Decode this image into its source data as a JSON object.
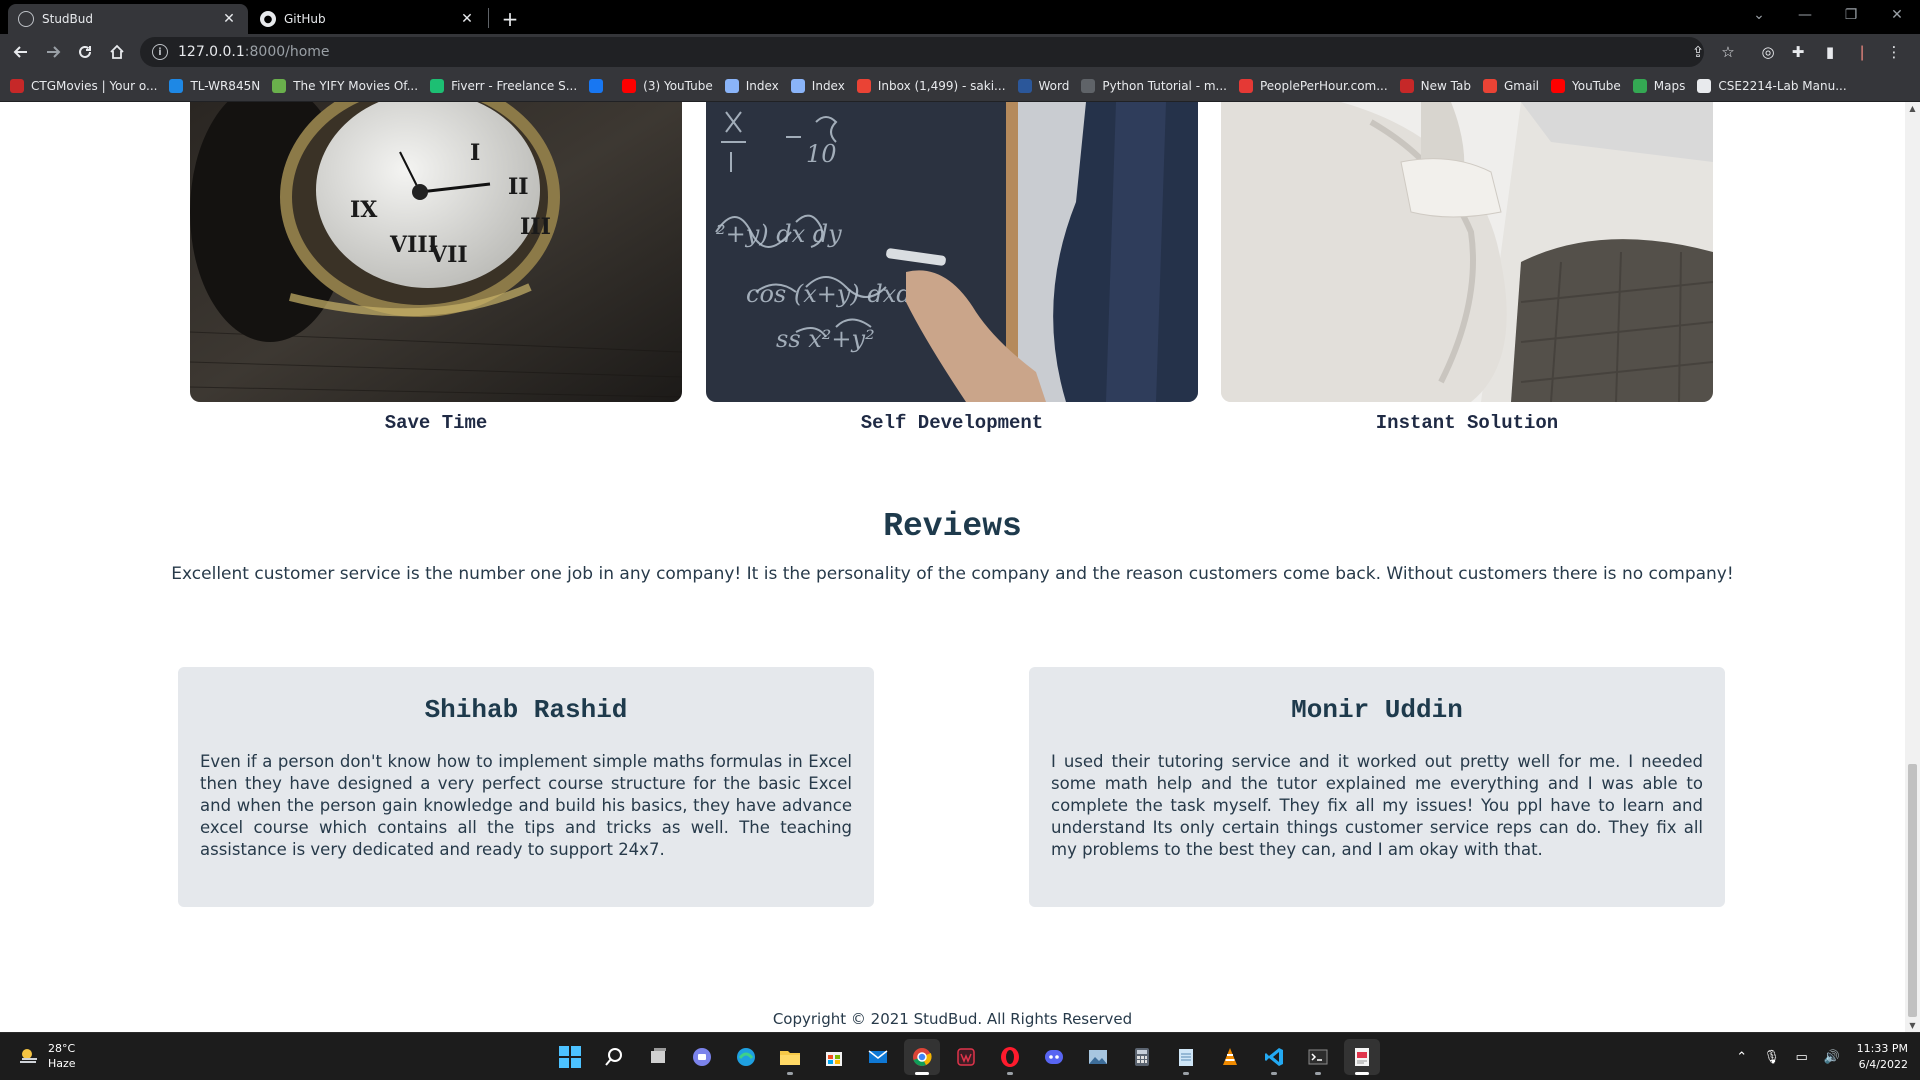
{
  "browser": {
    "tabs": [
      {
        "title": "StudBud",
        "active": true
      },
      {
        "title": "GitHub",
        "active": false
      }
    ],
    "url_host": "127.0.0.1",
    "url_path": ":8000/home",
    "bookmarks": [
      {
        "label": "CTGMovies | Your o...",
        "color": "#c62828"
      },
      {
        "label": "TL-WR845N",
        "color": "#1e88e5"
      },
      {
        "label": "The YIFY Movies Of...",
        "color": "#6ab04c"
      },
      {
        "label": "Fiverr - Freelance S...",
        "color": "#1dbf73"
      },
      {
        "label": "",
        "color": "#1877f2"
      },
      {
        "label": "(3) YouTube",
        "color": "#ff0000"
      },
      {
        "label": "Index",
        "color": "#8ab4f8"
      },
      {
        "label": "Index",
        "color": "#8ab4f8"
      },
      {
        "label": "Inbox (1,499) - saki...",
        "color": "#ea4335"
      },
      {
        "label": "Word",
        "color": "#2b579a"
      },
      {
        "label": "Python Tutorial - m...",
        "color": "#5f6368"
      },
      {
        "label": "PeoplePerHour.com...",
        "color": "#e53935"
      },
      {
        "label": "New Tab",
        "color": "#c62828"
      },
      {
        "label": "Gmail",
        "color": "#ea4335"
      },
      {
        "label": "YouTube",
        "color": "#ff0000"
      },
      {
        "label": "Maps",
        "color": "#34a853"
      },
      {
        "label": "CSE2214-Lab Manu...",
        "color": "#e8eaed"
      }
    ]
  },
  "features": [
    {
      "caption": "Save Time",
      "image": "pocket-watch"
    },
    {
      "caption": "Self Development",
      "image": "chalkboard-math"
    },
    {
      "caption": "Instant Solution",
      "image": "person-typing"
    }
  ],
  "reviews": {
    "title": "Reviews",
    "subtitle": "Excellent customer service is the number one job in any company! It is the personality of the company and the reason customers come back. Without customers there is no company!",
    "items": [
      {
        "name": "Shihab Rashid",
        "text": "Even if a person don't know how to implement simple maths formulas in Excel then they have designed a very perfect course structure for the basic Excel and when the person gain knowledge and build his basics, they have advance excel course which contains all the tips and tricks as well. The teaching assistance is very dedicated and ready to support 24x7."
      },
      {
        "name": "Monir Uddin",
        "text": "I used their tutoring service and it worked out pretty well for me. I needed some math help and the tutor explained me everything and I was able to complete the task myself. They fix all my issues! You ppl have to learn and understand Its only certain things customer service reps can do. They fix all my problems to the best they can, and I am okay with that."
      }
    ]
  },
  "footer": "Copyright © 2021 StudBud. All Rights Reserved",
  "taskbar": {
    "temperature": "28°C",
    "weather": "Haze",
    "time": "11:33 PM",
    "date": "6/4/2022"
  },
  "colors": {
    "heading": "#1e3a4c",
    "card_bg": "#e5e8ec",
    "chrome_bg": "#35363a"
  }
}
